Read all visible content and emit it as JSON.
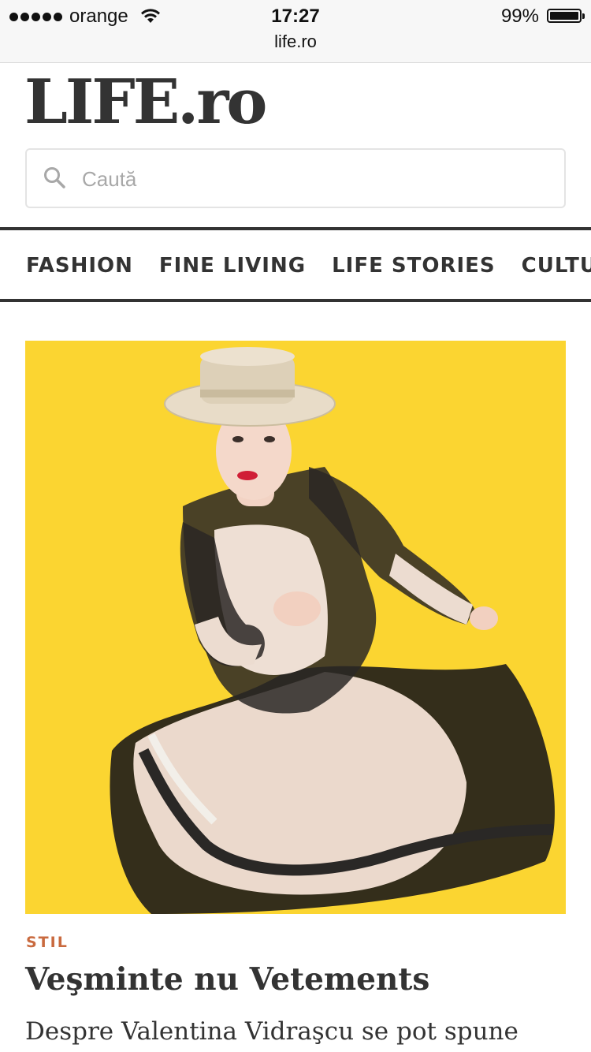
{
  "status_bar": {
    "carrier": "orange",
    "time": "17:27",
    "battery": "99%",
    "url": "life.ro"
  },
  "header": {
    "logo": "LIFE.ro",
    "search_placeholder": "Caută"
  },
  "nav": {
    "items": [
      "FASHION",
      "FINE LIVING",
      "LIFE STORIES",
      "CULTURĂ"
    ]
  },
  "article": {
    "category": "STIL",
    "title": "Veşminte nu Vetements",
    "excerpt": "Despre Valentina Vidraşcu se pot spune"
  },
  "colors": {
    "hero_background": "#fbd531",
    "category": "#c96a3f",
    "text": "#333333"
  }
}
